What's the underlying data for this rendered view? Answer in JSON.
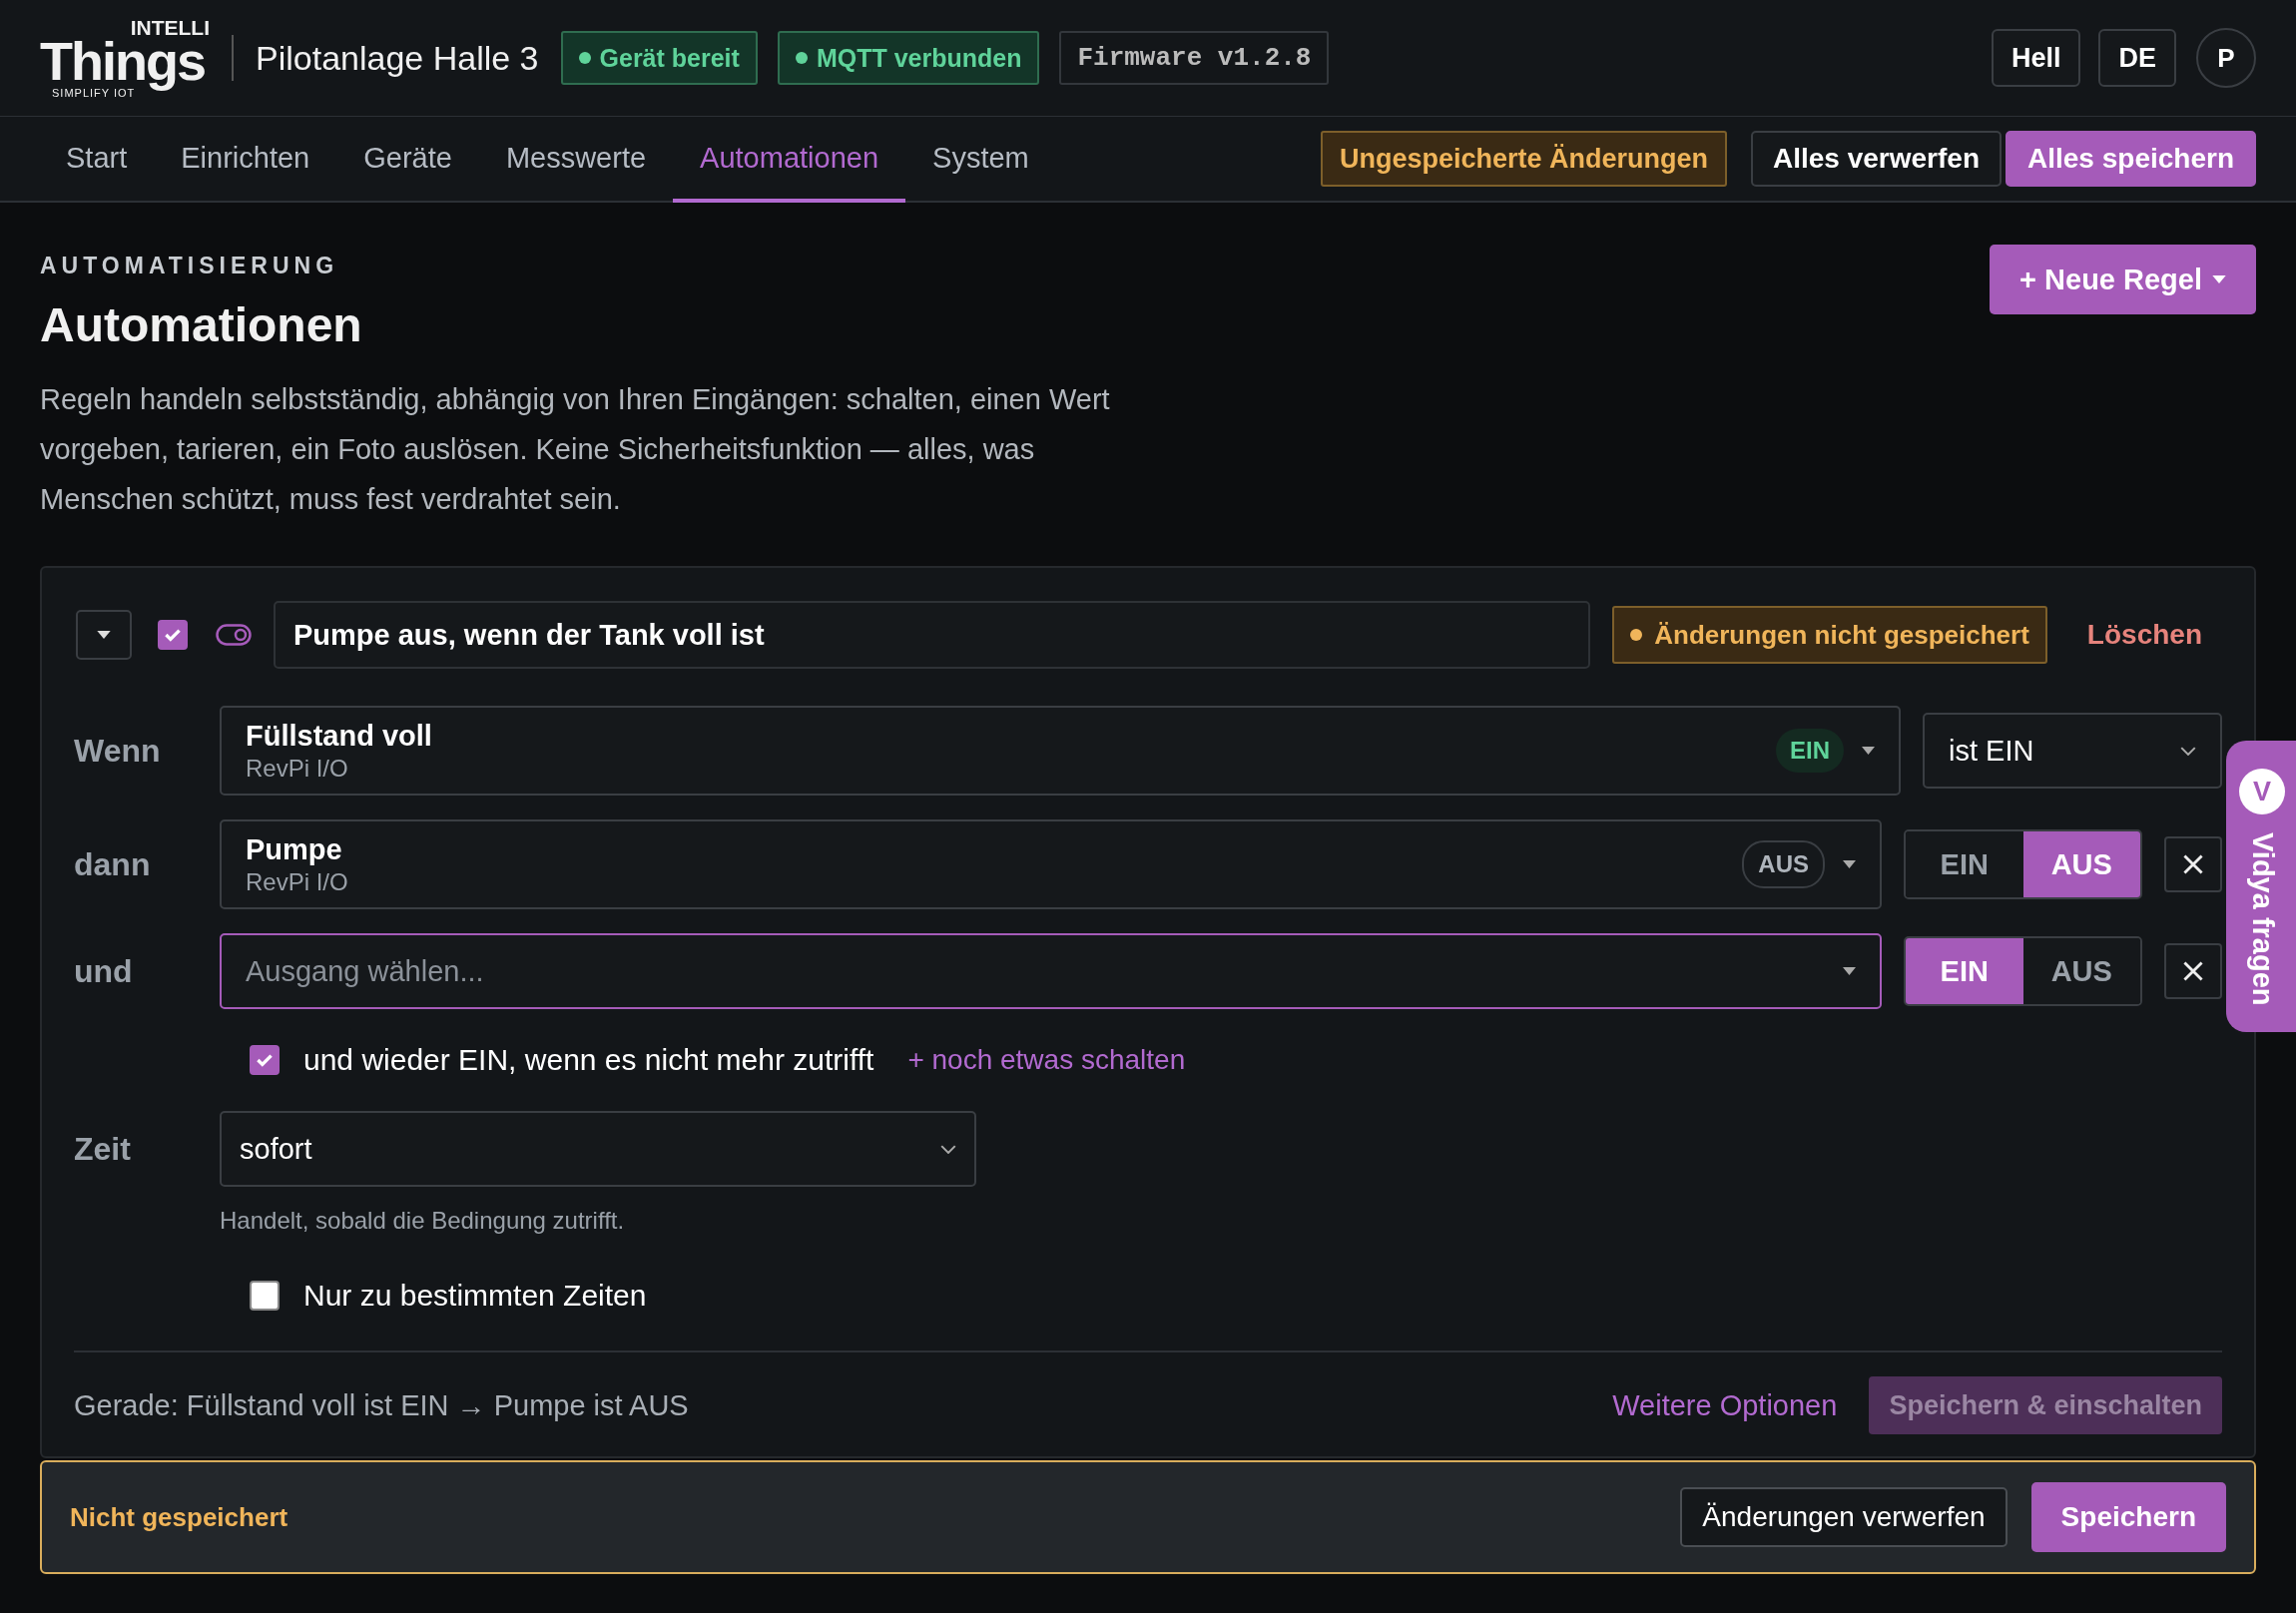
{
  "header": {
    "logo": {
      "top": "INTELLI",
      "main": "Things",
      "tagline": "SIMPLIFY IOT"
    },
    "site_title": "Pilotanlage Halle 3",
    "status_badges": [
      {
        "label": "Gerät bereit",
        "color": "#5fd39a"
      },
      {
        "label": "MQTT verbunden",
        "color": "#5fd39a"
      }
    ],
    "firmware": "Firmware v1.2.8",
    "buttons": [
      "Hell",
      "DE"
    ],
    "avatar": "P"
  },
  "nav": {
    "tabs": [
      {
        "label": "Start",
        "selected": false
      },
      {
        "label": "Einrichten",
        "selected": false
      },
      {
        "label": "Geräte",
        "selected": false
      },
      {
        "label": "Messwerte",
        "selected": false
      },
      {
        "label": "Automationen",
        "selected": true
      },
      {
        "label": "System",
        "selected": false
      }
    ],
    "unsaved_badge": "Ungespeicherte Änderungen",
    "buttons": [
      {
        "label": "Alles verwerfen",
        "kind": "secondary"
      },
      {
        "label": "Alles speichern",
        "kind": "primary"
      }
    ]
  },
  "page": {
    "eyebrow": "AUTOMATISIERUNG",
    "title": "Automationen",
    "description": "Regeln handeln selbstständig, abhängig von Ihren Eingängen: schalten, einen Wert vorgeben, tarieren, ein Foto auslösen. Keine Sicherheitsfunktion — alles, was Menschen schützt, muss fest verdrahtet sein.",
    "new_button": "+ Neue Regel"
  },
  "rule": {
    "expanded": true,
    "checked": true,
    "enabled": true,
    "name": "Pumpe aus, wenn der Tank voll ist",
    "status": "Änderungen nicht gespeichert",
    "delete": "Löschen",
    "condition": {
      "label": "Wenn",
      "input": "Füllstand voll",
      "source": "RevPi I/O",
      "state": "EIN",
      "state_on": true,
      "comparison": "ist EIN"
    },
    "actions": [
      {
        "label": "dann",
        "output": "Pumpe",
        "source": "RevPi I/O",
        "state": "AUS",
        "focused": false,
        "options": [
          {
            "label": "EIN",
            "selected": false
          },
          {
            "label": "AUS",
            "selected": true
          }
        ]
      },
      {
        "label": "und",
        "placeholder": "Ausgang wählen...",
        "focused": true,
        "options": [
          {
            "label": "EIN",
            "selected": true
          },
          {
            "label": "AUS",
            "selected": false
          }
        ]
      }
    ],
    "revert": {
      "checked": true,
      "label": "und wieder EIN, wenn es nicht mehr zutrifft"
    },
    "add_link": "+ noch etwas schalten",
    "time": {
      "label": "Zeit",
      "value": "sofort",
      "hint": "Handelt, sobald die Bedingung zutrifft."
    },
    "schedule": {
      "checked": false,
      "label": "Nur zu bestimmten Zeiten"
    },
    "summary": "Gerade: Füllstand voll ist EIN → Pumpe ist AUS",
    "more_link": "Weitere Optionen",
    "save_enable": {
      "label": "Speichern & einschalten",
      "disabled": true
    }
  },
  "save_bar": {
    "status": "Nicht gespeichert",
    "buttons": [
      {
        "label": "Änderungen verwerfen",
        "kind": "secondary"
      },
      {
        "label": "Speichern",
        "kind": "primary"
      }
    ]
  },
  "assistant_tab": {
    "avatar": "V",
    "label": "Vidya fragen"
  }
}
